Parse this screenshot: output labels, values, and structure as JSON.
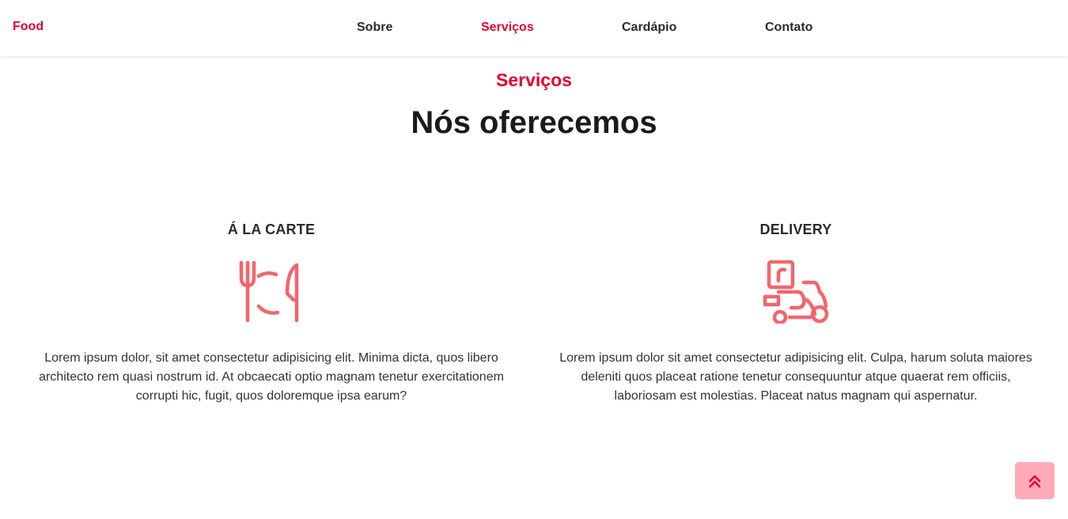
{
  "nav": {
    "brand": "Food",
    "links": [
      {
        "label": "Sobre",
        "active": false
      },
      {
        "label": "Serviços",
        "active": true
      },
      {
        "label": "Cardápio",
        "active": false
      },
      {
        "label": "Contato",
        "active": false
      }
    ]
  },
  "section": {
    "tag": "Serviços",
    "title": "Nós oferecemos"
  },
  "services": [
    {
      "title": "Á LA CARTE",
      "icon": "plate-cutlery-icon",
      "text": "Lorem ipsum dolor, sit amet consectetur adipisicing elit. Minima dicta, quos libero architecto rem quasi nostrum id. At obcaecati optio magnam tenetur exercitationem corrupti hic, fugit, quos doloremque ipsa earum?"
    },
    {
      "title": "DELIVERY",
      "icon": "delivery-scooter-icon",
      "text": "Lorem ipsum dolor sit amet consectetur adipisicing elit. Culpa, harum soluta maiores deleniti quos placeat ratione tenetur consequuntur atque quaerat rem officiis, laboriosam est molestias. Placeat natus magnam qui aspernatur."
    }
  ],
  "back_to_top": {
    "icon": "double-chevron-up-icon"
  },
  "colors": {
    "accent": "#e6002e",
    "icon": "#f4646c",
    "back_to_top_bg": "#ffabb7"
  }
}
